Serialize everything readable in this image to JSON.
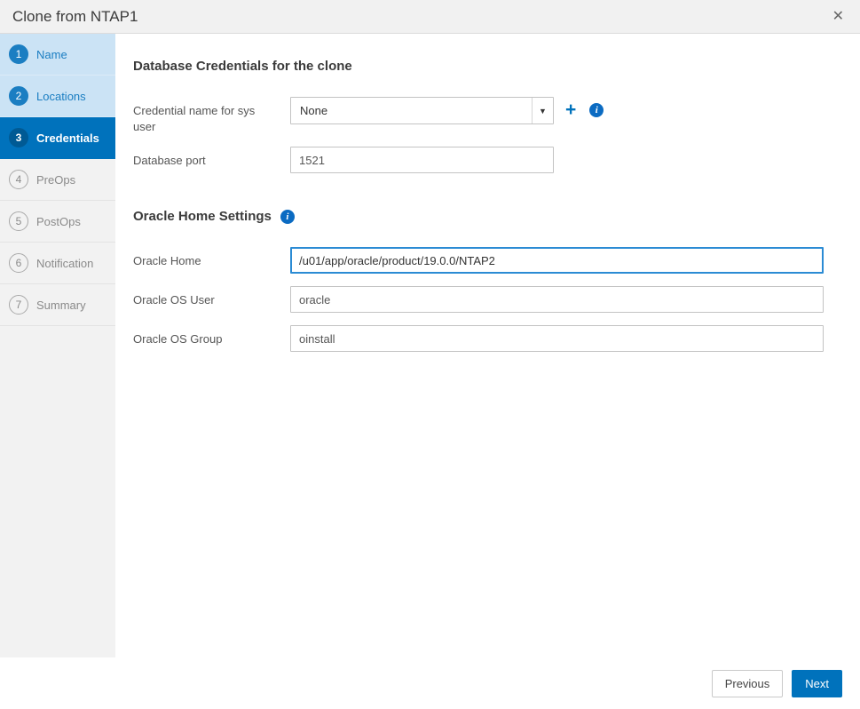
{
  "window": {
    "title": "Clone from NTAP1"
  },
  "icons": {
    "close": "✕",
    "plus": "+",
    "info": "i",
    "caret": "▼"
  },
  "sidebar": {
    "steps": [
      {
        "number": "1",
        "label": "Name"
      },
      {
        "number": "2",
        "label": "Locations"
      },
      {
        "number": "3",
        "label": "Credentials"
      },
      {
        "number": "4",
        "label": "PreOps"
      },
      {
        "number": "5",
        "label": "PostOps"
      },
      {
        "number": "6",
        "label": "Notification"
      },
      {
        "number": "7",
        "label": "Summary"
      }
    ]
  },
  "credentials_section": {
    "heading": "Database Credentials for the clone",
    "credential_name_label": "Credential name for sys user",
    "credential_name_value": "None",
    "database_port_label": "Database port",
    "database_port_value": "1521"
  },
  "oracle_section": {
    "heading": "Oracle Home Settings",
    "oracle_home_label": "Oracle Home",
    "oracle_home_value": "/u01/app/oracle/product/19.0.0/NTAP2",
    "oracle_os_user_label": "Oracle OS User",
    "oracle_os_user_value": "oracle",
    "oracle_os_group_label": "Oracle OS Group",
    "oracle_os_group_value": "oinstall"
  },
  "footer": {
    "previous_label": "Previous",
    "next_label": "Next"
  },
  "colors": {
    "accent": "#0072bc",
    "completed_bg": "#cbe3f5",
    "step_text": "#1b7ec2"
  }
}
